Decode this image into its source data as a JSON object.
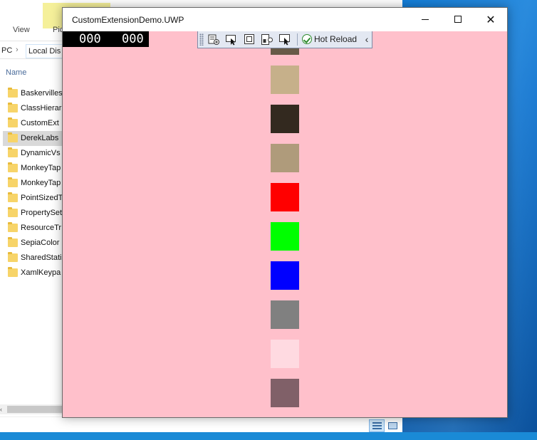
{
  "explorer": {
    "ribbon_tabs": [
      "View",
      "Pic"
    ],
    "address": {
      "pc": "PC",
      "disk": "Local Dis"
    },
    "column_name": "Name",
    "files": [
      "Baskervilles",
      "ClassHierar",
      "CustomExt",
      "DerekLabs",
      "DynamicVs",
      "MonkeyTap",
      "MonkeyTap",
      "PointSizedT",
      "PropertySet",
      "ResourceTr",
      "SepiaColor",
      "SharedStati",
      "XamlKeypa"
    ],
    "selected_index": 3
  },
  "app": {
    "title": "CustomExtensionDemo.UWP",
    "controls": {
      "close": "✕"
    },
    "frame_counter": {
      "left": "000",
      "right": "000"
    },
    "toolbar": {
      "icons": [
        "live-visual-tree-icon",
        "select-element-icon",
        "display-layout-adorners-icon",
        "track-focus-icon",
        "binding-failures-icon"
      ],
      "hot_reload_label": "Hot Reload",
      "collapse_glyph": "‹"
    },
    "background_color": "#ffc0cb",
    "swatches": [
      "#675a48",
      "#c6b08a",
      "#33291f",
      "#af9b7b",
      "#ff0000",
      "#00ff00",
      "#0000ff",
      "#808080",
      "#ffdae1",
      "#806068"
    ]
  }
}
